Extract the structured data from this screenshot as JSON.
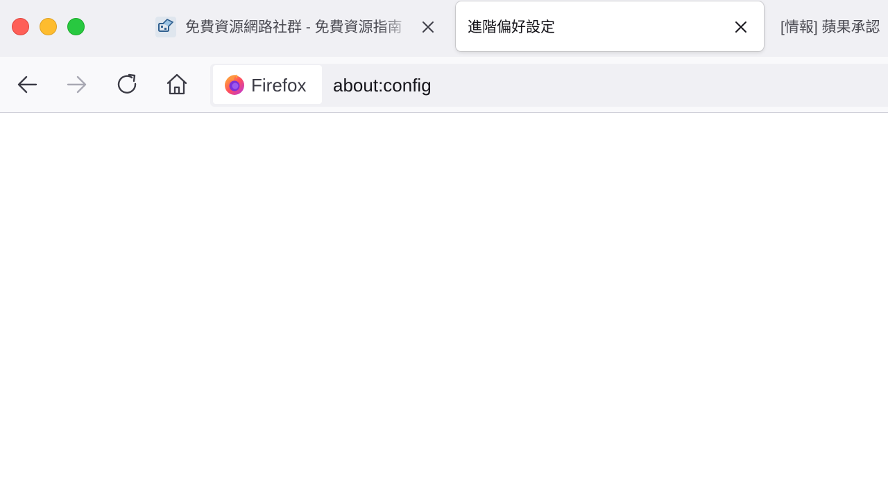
{
  "tabs": [
    {
      "title": "免費資源網路社群 - 免費資源指南",
      "active": false,
      "closable": true,
      "favicon": "site-favicon"
    },
    {
      "title": "進階偏好設定",
      "active": true,
      "closable": true
    },
    {
      "title": "[情報] 蘋果承認",
      "active": false
    }
  ],
  "nav": {
    "back_icon": "arrow-left-icon",
    "forward_icon": "arrow-right-icon",
    "reload_icon": "reload-icon",
    "home_icon": "home-icon"
  },
  "urlbar": {
    "identity_label": "Firefox",
    "identity_icon": "firefox-logo-icon",
    "url": "about:config"
  },
  "colors": {
    "traffic_close": "#fe5f57",
    "traffic_minimize": "#febc2e",
    "traffic_maximize": "#28c840",
    "tabstrip_bg": "#f0f0f4",
    "navbar_bg": "#f9f9fb"
  }
}
